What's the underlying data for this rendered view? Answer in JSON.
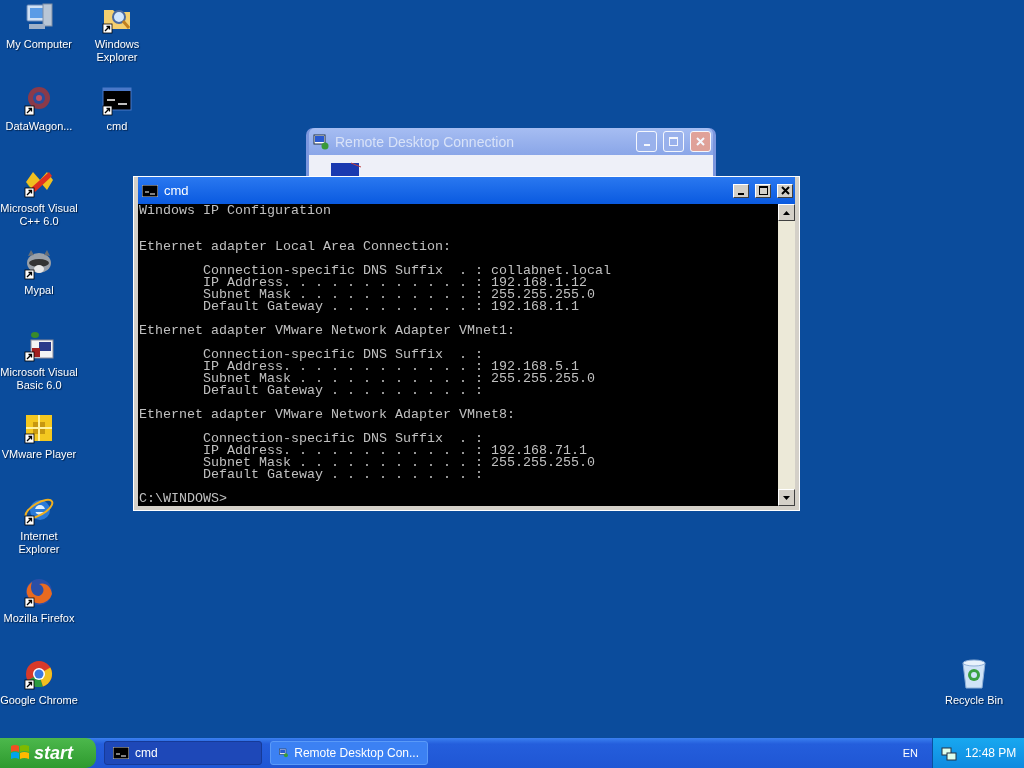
{
  "desktop_icons": [
    {
      "label": "My Computer",
      "kind": "computer",
      "shortcut": false
    },
    {
      "label": "DataWagon...",
      "kind": "gear",
      "shortcut": true
    },
    {
      "label": "Microsoft Visual C++ 6.0",
      "kind": "infinity",
      "shortcut": true
    },
    {
      "label": "Mypal",
      "kind": "animal",
      "shortcut": true
    },
    {
      "label": "Microsoft Visual Basic 6.0",
      "kind": "basic",
      "shortcut": true
    },
    {
      "label": "VMware Player",
      "kind": "vmware",
      "shortcut": true
    },
    {
      "label": "Internet Explorer",
      "kind": "ie",
      "shortcut": true
    },
    {
      "label": "Mozilla Firefox",
      "kind": "firefox",
      "shortcut": true
    },
    {
      "label": "Google Chrome",
      "kind": "chrome",
      "shortcut": true
    },
    {
      "label": "Windows Explorer",
      "kind": "folder",
      "shortcut": true
    },
    {
      "label": "cmd",
      "kind": "console",
      "shortcut": true
    }
  ],
  "recycle_bin": {
    "label": "Recycle Bin"
  },
  "background_window": {
    "title": "Remote Desktop Connection",
    "active": false
  },
  "cmd_window": {
    "title": "cmd",
    "active": true,
    "header": "Windows IP Configuration",
    "adapters": [
      {
        "title": "Ethernet adapter Local Area Connection:",
        "entries": [
          "Connection-specific DNS Suffix  . : collabnet.local",
          "IP Address. . . . . . . . . . . . : 192.168.1.12",
          "Subnet Mask . . . . . . . . . . . : 255.255.255.0",
          "Default Gateway . . . . . . . . . : 192.168.1.1"
        ]
      },
      {
        "title": "Ethernet adapter VMware Network Adapter VMnet1:",
        "entries": [
          "Connection-specific DNS Suffix  . :",
          "IP Address. . . . . . . . . . . . : 192.168.5.1",
          "Subnet Mask . . . . . . . . . . . : 255.255.255.0",
          "Default Gateway . . . . . . . . . :"
        ]
      },
      {
        "title": "Ethernet adapter VMware Network Adapter VMnet8:",
        "entries": [
          "Connection-specific DNS Suffix  . :",
          "IP Address. . . . . . . . . . . . : 192.168.71.1",
          "Subnet Mask . . . . . . . . . . . : 255.255.255.0",
          "Default Gateway . . . . . . . . . :"
        ]
      }
    ],
    "prompt": "C:\\WINDOWS>"
  },
  "taskbar": {
    "start": "start",
    "tasks": [
      {
        "label": "cmd",
        "kind": "console",
        "selected": true
      },
      {
        "label": "Remote Desktop Con...",
        "kind": "remote",
        "selected": false
      }
    ],
    "language": "EN",
    "clock": "12:48 PM"
  }
}
